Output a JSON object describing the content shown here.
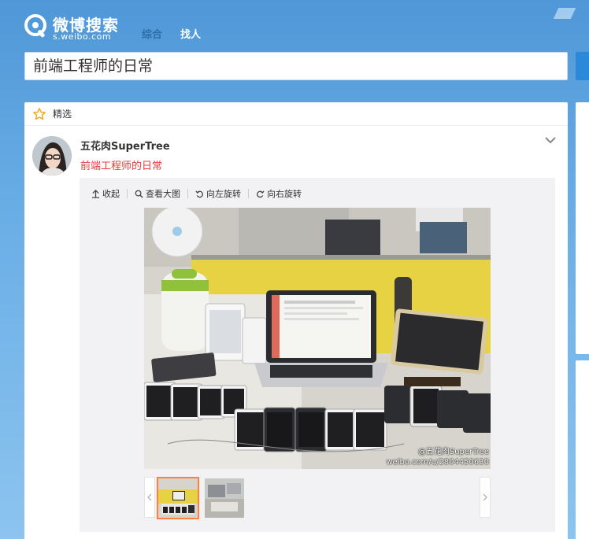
{
  "header": {
    "logo_text": "微博搜索",
    "logo_sub": "s.weibo.com",
    "tabs": [
      {
        "label": "综合",
        "active": true
      },
      {
        "label": "找人",
        "active": false
      }
    ]
  },
  "search": {
    "value": "前端工程师的日常"
  },
  "card": {
    "heading": "精选",
    "post": {
      "author": "五花肉SuperTree",
      "text": "前端工程师的日常"
    },
    "toolbar": [
      {
        "icon": "arrow-up-icon",
        "label": "收起"
      },
      {
        "icon": "magnifier-icon",
        "label": "查看大图"
      },
      {
        "icon": "rotate-left-icon",
        "label": "向左旋转"
      },
      {
        "icon": "rotate-right-icon",
        "label": "向右旋转"
      }
    ],
    "watermark": {
      "line1": "@五花肉SuperTree",
      "line2": "weibo.com/u/2804450630"
    },
    "thumbnails_count": 2,
    "selected_thumbnail": 1
  },
  "colors": {
    "accent_blue": "#2c88d9",
    "highlight_red": "#eb3b3b",
    "thumb_selected": "#ff8140"
  }
}
